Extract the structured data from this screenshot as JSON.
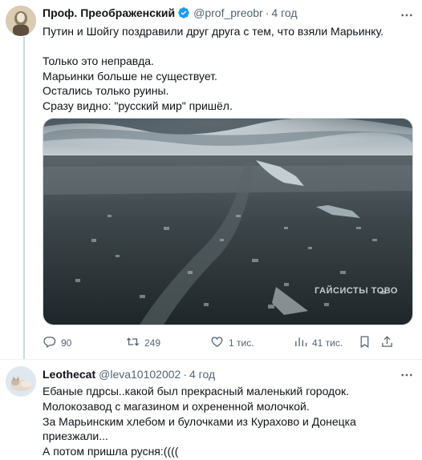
{
  "tweet1": {
    "author_name": "Проф. Преображенский",
    "handle": "@prof_preobr",
    "separator": "·",
    "time": "4 год",
    "text": "Путин и Шойгу поздравили друг друга с тем, что взяли Марьинку.\n\nТолько это неправда.\nМарьинки больше не существует.\nОстались только руины.\nСразу видно: \"русский мир\" пришёл.",
    "media_watermark": "ГАЙСИСТЬІ ТОВО",
    "actions": {
      "reply_count": "90",
      "retweet_count": "249",
      "like_count": "1 тис.",
      "views_count": "41 тис."
    }
  },
  "tweet2": {
    "author_name": "Leothecat",
    "handle": "@leva10102002",
    "separator": "·",
    "time": "4 год",
    "text": "Ебаные пдрсы..какой был прекрасный маленький городок.\nМолокозавод с магазином и охрененной молочкой.\nЗа Марьинским хлебом и булочками из Курахово и Донецка приезжали...\nА потом пришла русня:(((("
  },
  "icons": {
    "verified": "verified-badge-icon",
    "more": "more-icon",
    "reply": "reply-icon",
    "retweet": "retweet-icon",
    "like": "heart-icon",
    "views": "views-icon",
    "bookmark": "bookmark-icon",
    "share": "share-icon"
  },
  "colors": {
    "verified": "#1d9bf0",
    "secondary_text": "#536471",
    "divider": "#eff3f4"
  }
}
